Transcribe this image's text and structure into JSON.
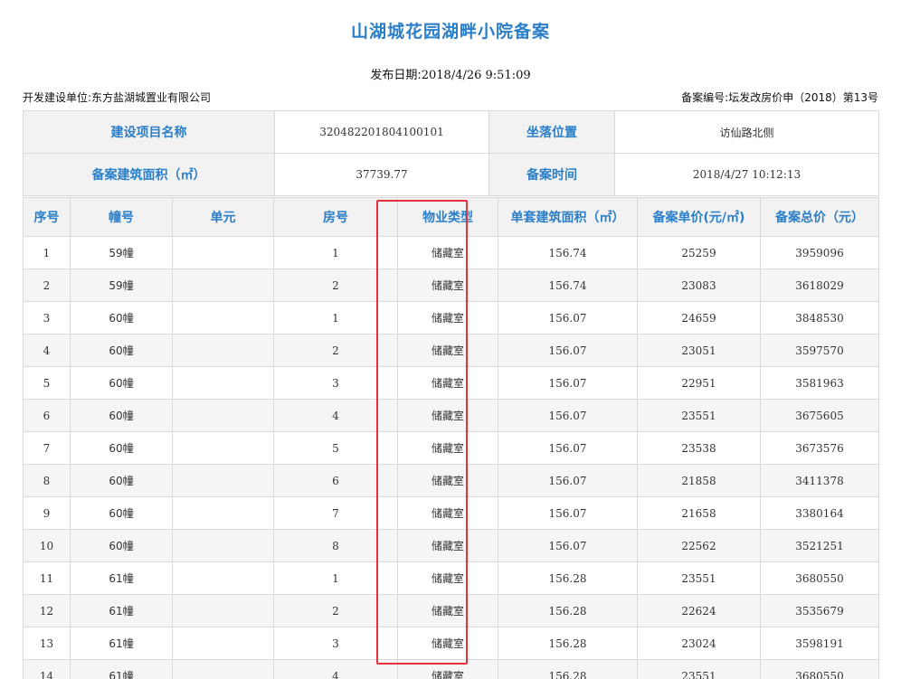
{
  "title": "山湖城花园湖畔小院备案",
  "publish": {
    "label": "发布日期:",
    "value": "2018/4/26 9:51:09"
  },
  "developer": {
    "label": "开发建设单位:",
    "value": "东方盐湖城置业有限公司"
  },
  "record_no": {
    "label": "备案编号:",
    "value": "坛发改房价申（2018）第13号"
  },
  "info": {
    "project_name_label": "建设项目名称",
    "project_name_value": "320482201804100101",
    "location_label": "坐落位置",
    "location_value": "访仙路北侧",
    "area_label": "备案建筑面积（㎡）",
    "area_value": "37739.77",
    "time_label": "备案时间",
    "time_value": "2018/4/27 10:12:13"
  },
  "columns": [
    "序号",
    "幢号",
    "单元",
    "房号",
    "物业类型",
    "单套建筑面积（㎡）",
    "备案单价(元/㎡)",
    "备案总价（元）"
  ],
  "rows": [
    [
      "1",
      "59幢",
      "",
      "1",
      "储藏室",
      "156.74",
      "25259",
      "3959096"
    ],
    [
      "2",
      "59幢",
      "",
      "2",
      "储藏室",
      "156.74",
      "23083",
      "3618029"
    ],
    [
      "3",
      "60幢",
      "",
      "1",
      "储藏室",
      "156.07",
      "24659",
      "3848530"
    ],
    [
      "4",
      "60幢",
      "",
      "2",
      "储藏室",
      "156.07",
      "23051",
      "3597570"
    ],
    [
      "5",
      "60幢",
      "",
      "3",
      "储藏室",
      "156.07",
      "22951",
      "3581963"
    ],
    [
      "6",
      "60幢",
      "",
      "4",
      "储藏室",
      "156.07",
      "23551",
      "3675605"
    ],
    [
      "7",
      "60幢",
      "",
      "5",
      "储藏室",
      "156.07",
      "23538",
      "3673576"
    ],
    [
      "8",
      "60幢",
      "",
      "6",
      "储藏室",
      "156.07",
      "21858",
      "3411378"
    ],
    [
      "9",
      "60幢",
      "",
      "7",
      "储藏室",
      "156.07",
      "21658",
      "3380164"
    ],
    [
      "10",
      "60幢",
      "",
      "8",
      "储藏室",
      "156.07",
      "22562",
      "3521251"
    ],
    [
      "11",
      "61幢",
      "",
      "1",
      "储藏室",
      "156.28",
      "23551",
      "3680550"
    ],
    [
      "12",
      "61幢",
      "",
      "2",
      "储藏室",
      "156.28",
      "22624",
      "3535679"
    ],
    [
      "13",
      "61幢",
      "",
      "3",
      "储藏室",
      "156.28",
      "23024",
      "3598191"
    ],
    [
      "14",
      "61幢",
      "",
      "4",
      "储藏室",
      "156.28",
      "23551",
      "3680550"
    ]
  ],
  "highlight_color": "#e3323b",
  "accent_color": "#2b7fc8"
}
